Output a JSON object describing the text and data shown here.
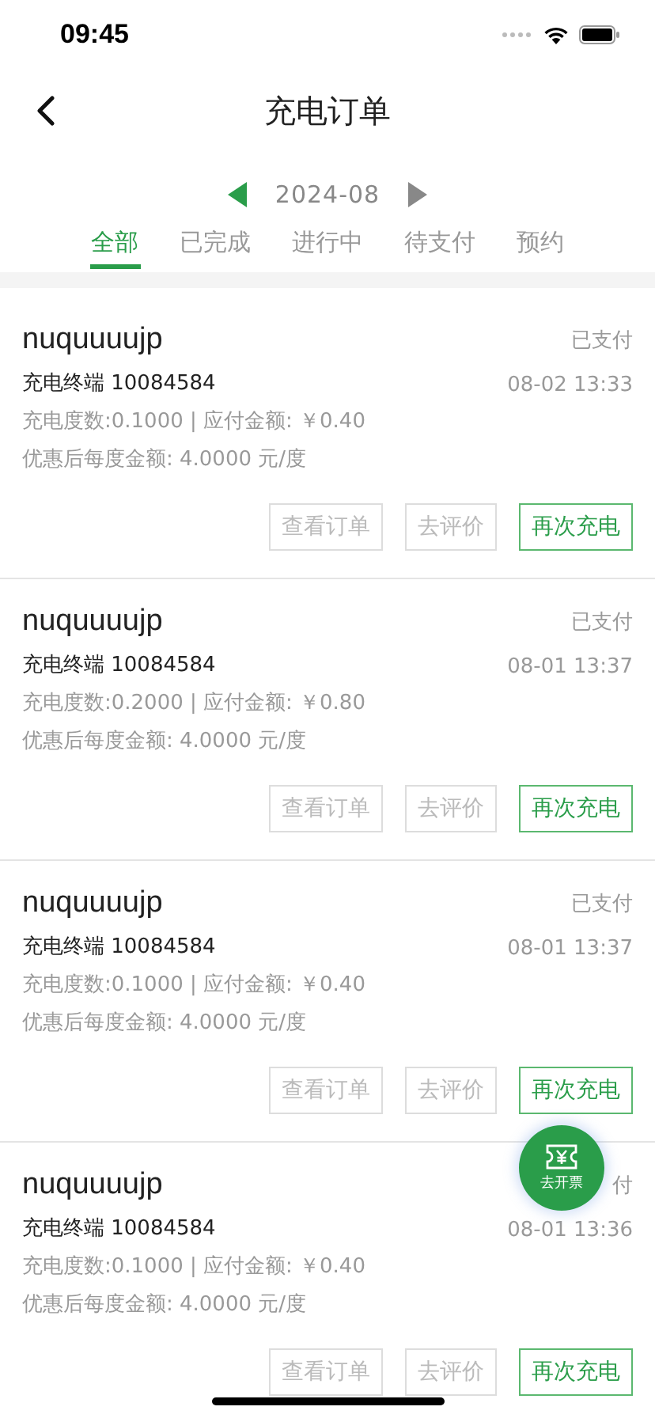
{
  "status_bar": {
    "time": "09:45"
  },
  "header": {
    "title": "充电订单"
  },
  "month": {
    "label": "2024-08"
  },
  "tabs": [
    {
      "label": "全部",
      "selected": true
    },
    {
      "label": "已完成",
      "selected": false
    },
    {
      "label": "进行中",
      "selected": false
    },
    {
      "label": "待支付",
      "selected": false
    },
    {
      "label": "预约",
      "selected": false
    }
  ],
  "orders": [
    {
      "name": "nuquuuujp",
      "status": "已支付",
      "terminal": "充电终端 10084584",
      "time": "08-02  13:33",
      "usage": "充电度数:0.1000 | 应付金额: ￥0.40",
      "unit_price": "优惠后每度金额: 4.0000 元/度",
      "buttons": [
        {
          "label": "查看订单",
          "primary": false
        },
        {
          "label": "去评价",
          "primary": false
        },
        {
          "label": "再次充电",
          "primary": true
        }
      ]
    },
    {
      "name": "nuquuuujp",
      "status": "已支付",
      "terminal": "充电终端 10084584",
      "time": "08-01  13:37",
      "usage": "充电度数:0.2000 | 应付金额: ￥0.80",
      "unit_price": "优惠后每度金额: 4.0000 元/度",
      "buttons": [
        {
          "label": "查看订单",
          "primary": false
        },
        {
          "label": "去评价",
          "primary": false
        },
        {
          "label": "再次充电",
          "primary": true
        }
      ]
    },
    {
      "name": "nuquuuujp",
      "status": "已支付",
      "terminal": "充电终端 10084584",
      "time": "08-01  13:37",
      "usage": "充电度数:0.1000 | 应付金额: ￥0.40",
      "unit_price": "优惠后每度金额: 4.0000 元/度",
      "buttons": [
        {
          "label": "查看订单",
          "primary": false
        },
        {
          "label": "去评价",
          "primary": false
        },
        {
          "label": "再次充电",
          "primary": true
        }
      ]
    },
    {
      "name": "nuquuuujp",
      "status": "付",
      "terminal": "充电终端 10084584",
      "time": "08-01  13:36",
      "usage": "充电度数:0.1000 | 应付金额: ￥0.40",
      "unit_price": "优惠后每度金额: 4.0000 元/度",
      "buttons": [
        {
          "label": "查看订单",
          "primary": false
        },
        {
          "label": "去评价",
          "primary": false
        },
        {
          "label": "再次充电",
          "primary": true
        }
      ]
    }
  ],
  "invoice_button": {
    "label": "去开票"
  }
}
